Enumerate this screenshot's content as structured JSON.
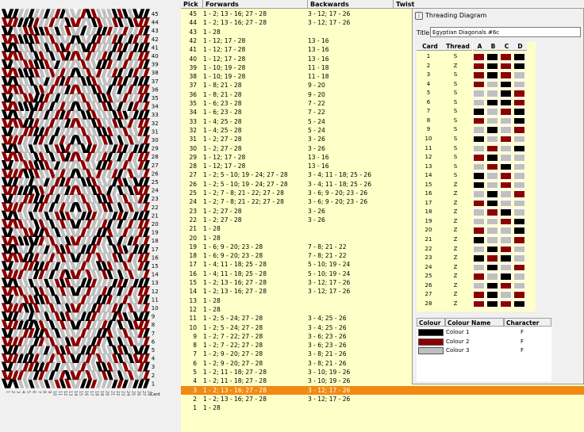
{
  "colors": {
    "c1": "#000000",
    "c2": "#8b0000",
    "c3": "#c0c0c0",
    "selected": "#f08a14"
  },
  "pattern": {
    "pick_labels": [
      "45",
      "44",
      "43",
      "42",
      "41",
      "40",
      "39",
      "38",
      "37",
      "36",
      "35",
      "34",
      "33",
      "32",
      "31",
      "30",
      "29",
      "28",
      "27",
      "26",
      "25",
      "24",
      "23",
      "22",
      "21",
      "20",
      "19",
      "18",
      "17",
      "16",
      "15",
      "14",
      "13",
      "12",
      "11",
      "10",
      "9",
      "8",
      "7",
      "6",
      "5",
      "4",
      "3",
      "2",
      "1"
    ],
    "card_axis_label": "Card"
  },
  "pick_table": {
    "headers": {
      "pick": "Pick",
      "forwards": "Forwards",
      "backwards": "Backwards",
      "twist": "Twist"
    },
    "selected_pick": "3",
    "rows": [
      {
        "pick": "45",
        "fwd": "1 - 2; 13 - 16; 27 - 28",
        "bwd": "3 - 12; 17 - 26"
      },
      {
        "pick": "44",
        "fwd": "1 - 2; 13 - 16; 27 - 28",
        "bwd": "3 - 12; 17 - 26"
      },
      {
        "pick": "43",
        "fwd": "1 - 28",
        "bwd": ""
      },
      {
        "pick": "42",
        "fwd": "1 - 12; 17 - 28",
        "bwd": "13 - 16"
      },
      {
        "pick": "41",
        "fwd": "1 - 12; 17 - 28",
        "bwd": "13 - 16"
      },
      {
        "pick": "40",
        "fwd": "1 - 12; 17 - 28",
        "bwd": "13 - 16"
      },
      {
        "pick": "39",
        "fwd": "1 - 10; 19 - 28",
        "bwd": "11 - 18"
      },
      {
        "pick": "38",
        "fwd": "1 - 10; 19 - 28",
        "bwd": "11 - 18"
      },
      {
        "pick": "37",
        "fwd": "1 - 8; 21 - 28",
        "bwd": "9 - 20"
      },
      {
        "pick": "36",
        "fwd": "1 - 8; 21 - 28",
        "bwd": "9 - 20"
      },
      {
        "pick": "35",
        "fwd": "1 - 6; 23 - 28",
        "bwd": "7 - 22"
      },
      {
        "pick": "34",
        "fwd": "1 - 6; 23 - 28",
        "bwd": "7 - 22"
      },
      {
        "pick": "33",
        "fwd": "1 - 4; 25 - 28",
        "bwd": "5 - 24"
      },
      {
        "pick": "32",
        "fwd": "1 - 4; 25 - 28",
        "bwd": "5 - 24"
      },
      {
        "pick": "31",
        "fwd": "1 - 2; 27 - 28",
        "bwd": "3 - 26"
      },
      {
        "pick": "30",
        "fwd": "1 - 2; 27 - 28",
        "bwd": "3 - 26"
      },
      {
        "pick": "29",
        "fwd": "1 - 12; 17 - 28",
        "bwd": "13 - 16"
      },
      {
        "pick": "28",
        "fwd": "1 - 12; 17 - 28",
        "bwd": "13 - 16"
      },
      {
        "pick": "27",
        "fwd": "1 - 2; 5 - 10; 19 - 24; 27 - 28",
        "bwd": "3 - 4; 11 - 18; 25 - 26"
      },
      {
        "pick": "26",
        "fwd": "1 - 2; 5 - 10; 19 - 24; 27 - 28",
        "bwd": "3 - 4; 11 - 18; 25 - 26"
      },
      {
        "pick": "25",
        "fwd": "1 - 2; 7 - 8; 21 - 22; 27 - 28",
        "bwd": "3 - 6; 9 - 20; 23 - 26"
      },
      {
        "pick": "24",
        "fwd": "1 - 2; 7 - 8; 21 - 22; 27 - 28",
        "bwd": "3 - 6; 9 - 20; 23 - 26"
      },
      {
        "pick": "23",
        "fwd": "1 - 2; 27 - 28",
        "bwd": "3 - 26"
      },
      {
        "pick": "22",
        "fwd": "1 - 2; 27 - 28",
        "bwd": "3 - 26"
      },
      {
        "pick": "21",
        "fwd": "1 - 28",
        "bwd": ""
      },
      {
        "pick": "20",
        "fwd": "1 - 28",
        "bwd": ""
      },
      {
        "pick": "19",
        "fwd": "1 - 6; 9 - 20; 23 - 28",
        "bwd": "7 - 8; 21 - 22"
      },
      {
        "pick": "18",
        "fwd": "1 - 6; 9 - 20; 23 - 28",
        "bwd": "7 - 8; 21 - 22"
      },
      {
        "pick": "17",
        "fwd": "1 - 4; 11 - 18; 25 - 28",
        "bwd": "5 - 10; 19 - 24"
      },
      {
        "pick": "16",
        "fwd": "1 - 4; 11 - 18; 25 - 28",
        "bwd": "5 - 10; 19 - 24"
      },
      {
        "pick": "15",
        "fwd": "1 - 2; 13 - 16; 27 - 28",
        "bwd": "3 - 12; 17 - 26"
      },
      {
        "pick": "14",
        "fwd": "1 - 2; 13 - 16; 27 - 28",
        "bwd": "3 - 12; 17 - 26"
      },
      {
        "pick": "13",
        "fwd": "1 - 28",
        "bwd": ""
      },
      {
        "pick": "12",
        "fwd": "1 - 28",
        "bwd": ""
      },
      {
        "pick": "11",
        "fwd": "1 - 2; 5 - 24; 27 - 28",
        "bwd": "3 - 4; 25 - 26"
      },
      {
        "pick": "10",
        "fwd": "1 - 2; 5 - 24; 27 - 28",
        "bwd": "3 - 4; 25 - 26"
      },
      {
        "pick": "9",
        "fwd": "1 - 2; 7 - 22; 27 - 28",
        "bwd": "3 - 6; 23 - 26"
      },
      {
        "pick": "8",
        "fwd": "1 - 2; 7 - 22; 27 - 28",
        "bwd": "3 - 6; 23 - 26"
      },
      {
        "pick": "7",
        "fwd": "1 - 2; 9 - 20; 27 - 28",
        "bwd": "3 - 8; 21 - 26"
      },
      {
        "pick": "6",
        "fwd": "1 - 2; 9 - 20; 27 - 28",
        "bwd": "3 - 8; 21 - 26"
      },
      {
        "pick": "5",
        "fwd": "1 - 2; 11 - 18; 27 - 28",
        "bwd": "3 - 10; 19 - 26"
      },
      {
        "pick": "4",
        "fwd": "1 - 2; 11 - 18; 27 - 28",
        "bwd": "3 - 10; 19 - 26"
      },
      {
        "pick": "3",
        "fwd": "1 - 2; 13 - 16; 27 - 28",
        "bwd": "3 - 12; 17 - 26"
      },
      {
        "pick": "2",
        "fwd": "1 - 2; 13 - 16; 27 - 28",
        "bwd": "3 - 12; 17 - 26"
      },
      {
        "pick": "1",
        "fwd": "1 - 28",
        "bwd": ""
      }
    ]
  },
  "threading": {
    "window_title": "Threading Diagram",
    "title_label": "Title",
    "title_value": "Egyptian Diagonals #6c",
    "headers": {
      "card": "Card",
      "thread": "Thread",
      "a": "A",
      "b": "B",
      "c": "C",
      "d": "D"
    },
    "cards": [
      {
        "n": "1",
        "t": "S",
        "h": [
          2,
          1,
          2,
          1
        ]
      },
      {
        "n": "2",
        "t": "Z",
        "h": [
          2,
          1,
          2,
          1
        ]
      },
      {
        "n": "3",
        "t": "S",
        "h": [
          2,
          1,
          2,
          3
        ]
      },
      {
        "n": "4",
        "t": "S",
        "h": [
          2,
          3,
          1,
          3
        ]
      },
      {
        "n": "5",
        "t": "S",
        "h": [
          3,
          3,
          1,
          2
        ]
      },
      {
        "n": "6",
        "t": "S",
        "h": [
          3,
          1,
          1,
          2
        ]
      },
      {
        "n": "7",
        "t": "S",
        "h": [
          1,
          3,
          2,
          1
        ]
      },
      {
        "n": "8",
        "t": "S",
        "h": [
          2,
          3,
          3,
          1
        ]
      },
      {
        "n": "9",
        "t": "S",
        "h": [
          3,
          1,
          3,
          2
        ]
      },
      {
        "n": "10",
        "t": "S",
        "h": [
          1,
          3,
          2,
          3
        ]
      },
      {
        "n": "11",
        "t": "S",
        "h": [
          3,
          2,
          3,
          1
        ]
      },
      {
        "n": "12",
        "t": "S",
        "h": [
          2,
          1,
          3,
          3
        ]
      },
      {
        "n": "13",
        "t": "S",
        "h": [
          3,
          2,
          1,
          3
        ]
      },
      {
        "n": "14",
        "t": "S",
        "h": [
          1,
          3,
          2,
          3
        ]
      },
      {
        "n": "15",
        "t": "Z",
        "h": [
          1,
          3,
          2,
          3
        ]
      },
      {
        "n": "16",
        "t": "Z",
        "h": [
          3,
          1,
          3,
          2
        ]
      },
      {
        "n": "17",
        "t": "Z",
        "h": [
          2,
          1,
          3,
          3
        ]
      },
      {
        "n": "18",
        "t": "Z",
        "h": [
          3,
          2,
          1,
          3
        ]
      },
      {
        "n": "19",
        "t": "Z",
        "h": [
          3,
          3,
          2,
          1
        ]
      },
      {
        "n": "20",
        "t": "Z",
        "h": [
          2,
          3,
          3,
          1
        ]
      },
      {
        "n": "21",
        "t": "Z",
        "h": [
          1,
          3,
          3,
          2
        ]
      },
      {
        "n": "22",
        "t": "Z",
        "h": [
          3,
          1,
          2,
          3
        ]
      },
      {
        "n": "23",
        "t": "Z",
        "h": [
          1,
          2,
          1,
          3
        ]
      },
      {
        "n": "24",
        "t": "Z",
        "h": [
          3,
          1,
          3,
          2
        ]
      },
      {
        "n": "25",
        "t": "Z",
        "h": [
          2,
          3,
          1,
          3
        ]
      },
      {
        "n": "26",
        "t": "Z",
        "h": [
          3,
          1,
          2,
          3
        ]
      },
      {
        "n": "27",
        "t": "Z",
        "h": [
          2,
          1,
          3,
          2
        ]
      },
      {
        "n": "28",
        "t": "Z",
        "h": [
          2,
          1,
          2,
          1
        ]
      }
    ],
    "colour_headers": {
      "colour": "Colour",
      "name": "Colour Name",
      "character": "Character"
    },
    "colours": [
      {
        "name": "Colour 1",
        "char": "F",
        "hex": "#000000"
      },
      {
        "name": "Colour 2",
        "char": "F",
        "hex": "#8b0000"
      },
      {
        "name": "Colour 3",
        "char": "F",
        "hex": "#c0c0c0"
      }
    ]
  }
}
